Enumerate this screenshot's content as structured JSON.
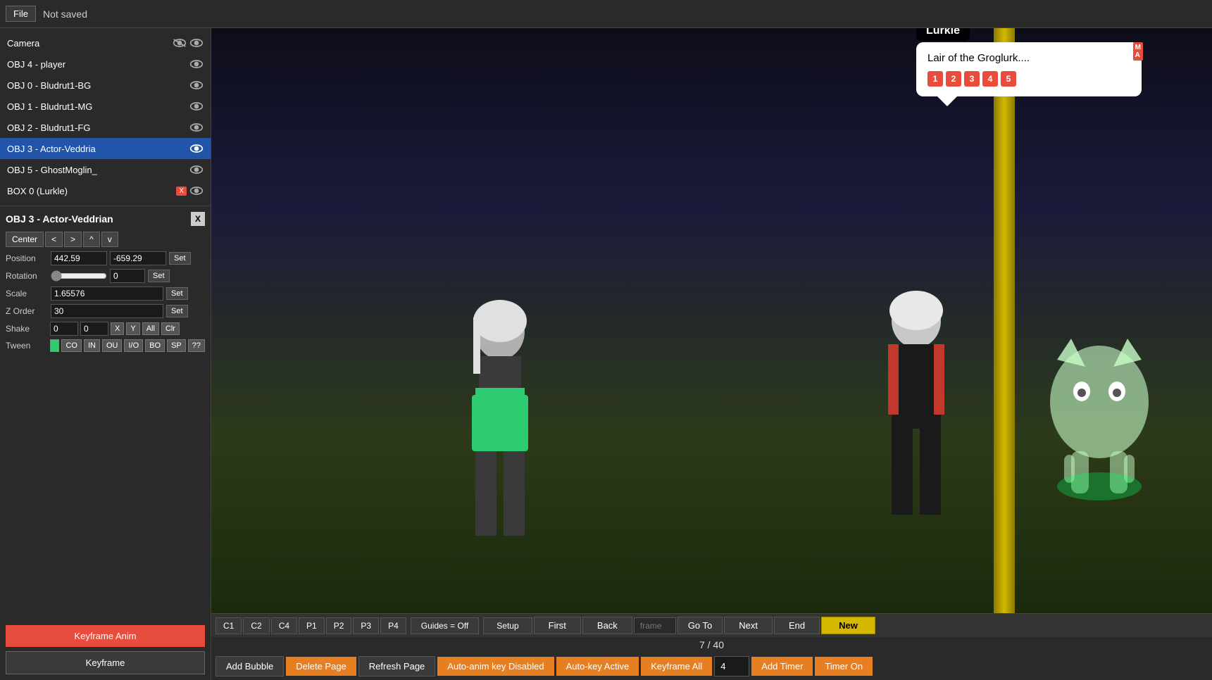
{
  "topbar": {
    "file_label": "File",
    "save_status": "Not saved"
  },
  "left_panel": {
    "objects": [
      {
        "id": "camera",
        "label": "Camera",
        "selected": false,
        "has_x": false,
        "dual_eye": true
      },
      {
        "id": "obj4",
        "label": "OBJ 4 - player",
        "selected": false,
        "has_x": false,
        "dual_eye": false
      },
      {
        "id": "obj0",
        "label": "OBJ 0 - Bludrut1-BG",
        "selected": false,
        "has_x": false,
        "dual_eye": false
      },
      {
        "id": "obj1",
        "label": "OBJ 1 - Bludrut1-MG",
        "selected": false,
        "has_x": false,
        "dual_eye": false
      },
      {
        "id": "obj2",
        "label": "OBJ 2 - Bludrut1-FG",
        "selected": false,
        "has_x": false,
        "dual_eye": false
      },
      {
        "id": "obj3",
        "label": "OBJ 3 - Actor-Veddria",
        "selected": true,
        "has_x": false,
        "dual_eye": false
      },
      {
        "id": "obj5",
        "label": "OBJ 5 - GhostMoglin_",
        "selected": false,
        "has_x": false,
        "dual_eye": false
      },
      {
        "id": "box0",
        "label": "BOX 0 (Lurkle)",
        "selected": false,
        "has_x": true,
        "dual_eye": false
      }
    ],
    "props": {
      "title": "OBJ 3 - Actor-Veddrian",
      "center_btn": "Center",
      "nav_left": "<",
      "nav_right": ">",
      "nav_up": "^",
      "nav_down": "v",
      "position_label": "Position",
      "position_x": "442.59",
      "position_y": "-659.29",
      "position_set": "Set",
      "rotation_label": "Rotation",
      "rotation_value": "0",
      "rotation_set": "Set",
      "scale_label": "Scale",
      "scale_value": "1.65576",
      "scale_set": "Set",
      "zorder_label": "Z Order",
      "zorder_value": "30",
      "zorder_set": "Set",
      "shake_label": "Shake",
      "shake_x": "0",
      "shake_y": "0",
      "shake_x_btn": "X",
      "shake_y_btn": "Y",
      "shake_all_btn": "All",
      "shake_clr_btn": "Clr",
      "tween_label": "Tween",
      "tween_codes": [
        "CO",
        "IN",
        "OU",
        "I/O",
        "BO",
        "SP",
        "??"
      ]
    },
    "action_btns": {
      "keyframe_anim": "Keyframe Anim",
      "keyframe": "Keyframe"
    }
  },
  "dialogue": {
    "character_name": "Lurkle",
    "text": "Lair of the Groglurk....",
    "numbers": [
      "1",
      "2",
      "3",
      "4",
      "5"
    ],
    "ma_badge": "M\nA"
  },
  "nav_bar": {
    "c_buttons": [
      "C1",
      "C2",
      "C4"
    ],
    "p_buttons": [
      "P1",
      "P2",
      "P3",
      "P4"
    ],
    "guides_label": "Guides = Off",
    "setup_label": "Setup",
    "first_label": "First",
    "back_label": "Back",
    "frame_placeholder": "frame",
    "goto_label": "Go To",
    "next_label": "Next",
    "end_label": "End",
    "new_label": "New",
    "page_counter": "7 / 40"
  },
  "action_bar": {
    "add_bubble": "Add Bubble",
    "delete_page": "Delete Page",
    "refresh_page": "Refresh Page",
    "auto_anim": "Auto-anim key Disabled",
    "auto_key": "Auto-key Active",
    "keyframe_all": "Keyframe All",
    "frame_number": "4",
    "add_timer": "Add Timer",
    "timer_on": "Timer On"
  }
}
